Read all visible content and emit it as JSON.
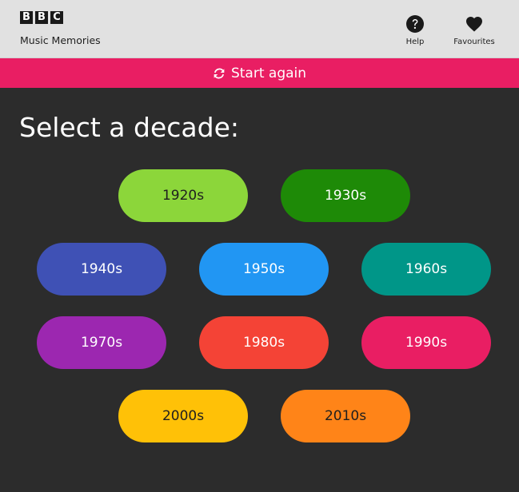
{
  "header": {
    "logo_letters": [
      "B",
      "B",
      "C"
    ],
    "app_title": "Music Memories",
    "nav": {
      "help": {
        "label": "Help",
        "icon": "question-circle-icon"
      },
      "favourites": {
        "label": "Favourites",
        "icon": "heart-icon"
      }
    }
  },
  "start_again": {
    "label": "Start again",
    "icon": "refresh-icon",
    "color": "#e91e63"
  },
  "heading": "Select a decade:",
  "decades": [
    {
      "label": "1920s",
      "color": "#8cd63a",
      "text_color": "#1f1f1f"
    },
    {
      "label": "1930s",
      "color": "#1e8a07",
      "text_color": "#ffffff"
    },
    {
      "label": "1940s",
      "color": "#3f51b5",
      "text_color": "#ffffff"
    },
    {
      "label": "1950s",
      "color": "#2196f3",
      "text_color": "#ffffff"
    },
    {
      "label": "1960s",
      "color": "#009688",
      "text_color": "#ffffff"
    },
    {
      "label": "1970s",
      "color": "#9c27b0",
      "text_color": "#ffffff"
    },
    {
      "label": "1980s",
      "color": "#f44336",
      "text_color": "#ffffff"
    },
    {
      "label": "1990s",
      "color": "#e91e63",
      "text_color": "#ffffff"
    },
    {
      "label": "2000s",
      "color": "#ffc107",
      "text_color": "#1f1f1f"
    },
    {
      "label": "2010s",
      "color": "#ff8418",
      "text_color": "#1f1f1f"
    }
  ]
}
